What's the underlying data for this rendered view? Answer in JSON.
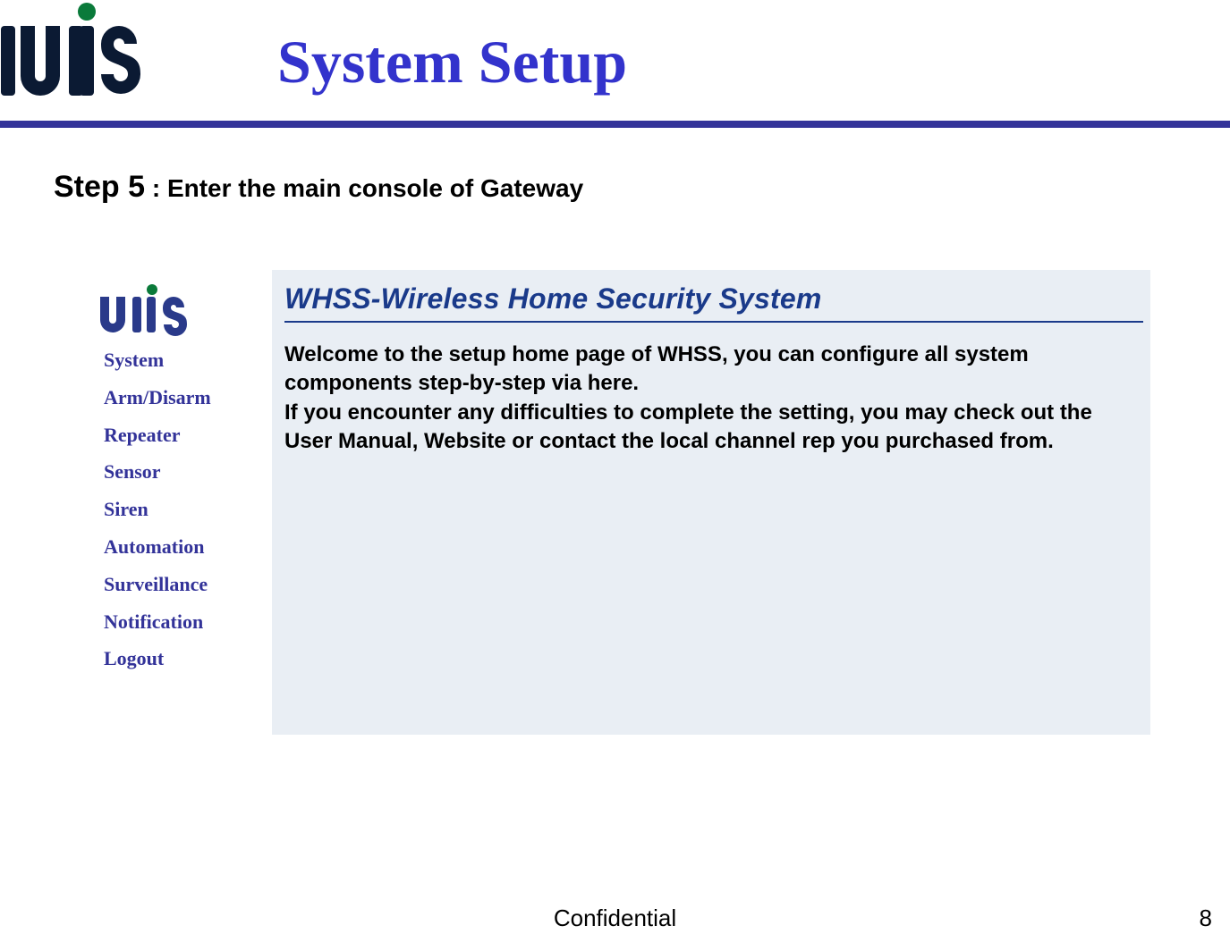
{
  "header": {
    "logo_text": "UIS",
    "title": "System Setup"
  },
  "step": {
    "label": "Step 5",
    "sep": " : ",
    "desc": "Enter the main console of Gateway"
  },
  "console": {
    "side_logo_text": "uis",
    "nav": {
      "items": [
        {
          "label": "System"
        },
        {
          "label": "Arm/Disarm"
        },
        {
          "label": "Repeater"
        },
        {
          "label": "Sensor"
        },
        {
          "label": "Siren"
        },
        {
          "label": "Automation"
        },
        {
          "label": "Surveillance"
        },
        {
          "label": "Notification"
        },
        {
          "label": "Logout"
        }
      ]
    },
    "content": {
      "title": "WHSS-Wireless Home Security System",
      "body": "Welcome to the setup home page of WHSS, you can configure all system components step-by-step via here.\nIf you encounter any difficulties to complete the setting, you may check out the User Manual, Website or contact the local channel rep you purchased from."
    }
  },
  "footer": {
    "center": "Confidential",
    "page": "8"
  }
}
